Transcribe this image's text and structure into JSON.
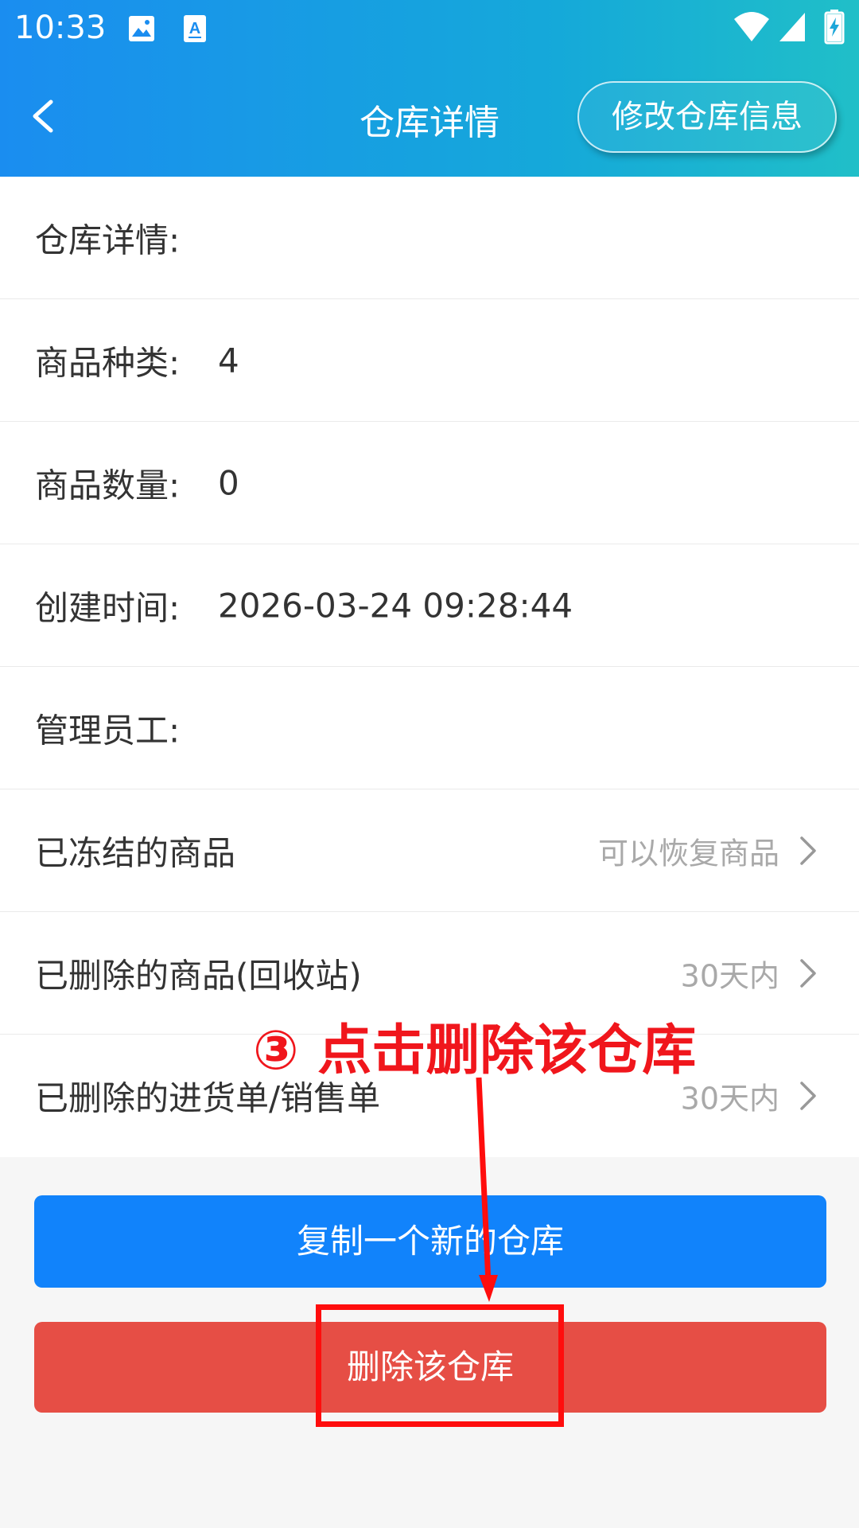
{
  "status_bar": {
    "time": "10:33",
    "icons": [
      "image-icon",
      "text-a-icon",
      "wifi-icon",
      "signal-icon",
      "battery-charging-icon"
    ]
  },
  "app_bar": {
    "title": "仓库详情",
    "edit_button_label": "修改仓库信息",
    "back_icon": "chevron-left-icon"
  },
  "details": {
    "description_label": "仓库详情:",
    "description_value": "",
    "category_label": "商品种类:",
    "category_value": "4",
    "quantity_label": "商品数量:",
    "quantity_value": "0",
    "created_label": "创建时间:",
    "created_value": "2026-03-24 09:28:44",
    "staff_label": "管理员工:",
    "staff_value": ""
  },
  "links": [
    {
      "label": "已冻结的商品",
      "hint": "可以恢复商品"
    },
    {
      "label": "已删除的商品(回收站)",
      "hint": "30天内"
    },
    {
      "label": "已删除的进货单/销售单",
      "hint": "30天内"
    }
  ],
  "actions": {
    "copy_label": "复制一个新的仓库",
    "delete_label": "删除该仓库"
  },
  "annotation": {
    "text": "③ 点击删除该仓库",
    "color": "#f0161c"
  },
  "colors": {
    "header_start": "#1a8df0",
    "header_end": "#20bfc8",
    "copy_button": "#1183fb",
    "delete_button": "#e64e45"
  }
}
